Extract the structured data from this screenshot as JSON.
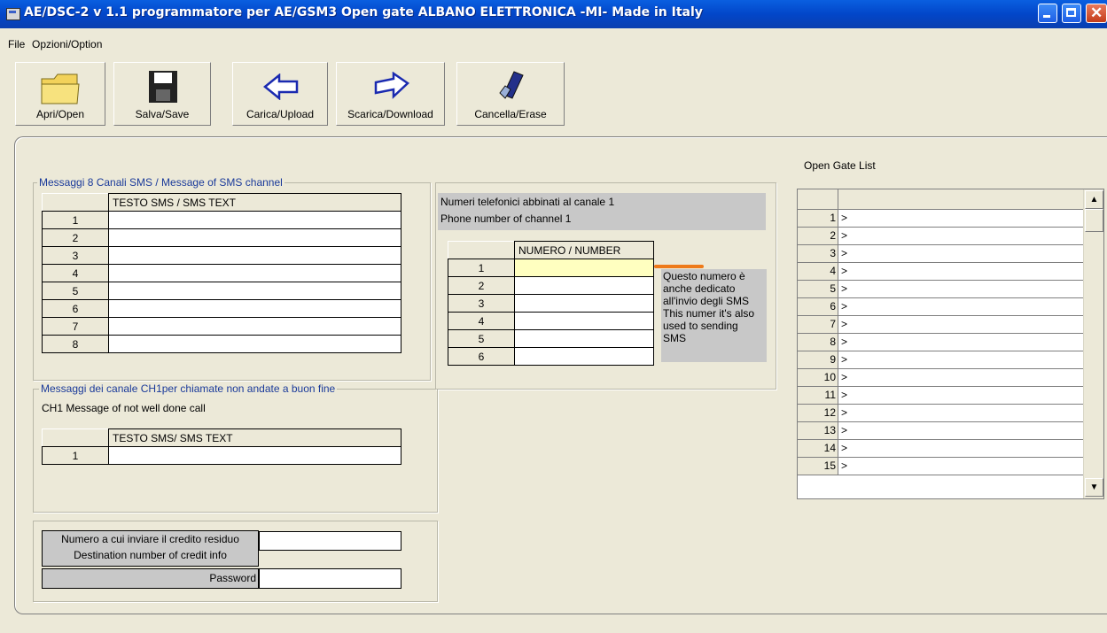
{
  "window": {
    "title": "AE/DSC-2 v 1.1 programmatore per AE/GSM3 Open gate ALBANO ELETTRONICA -MI- Made in Italy"
  },
  "menu": [
    "File",
    "Opzioni/Option"
  ],
  "toolbar": {
    "open": "Apri/Open",
    "save": "Salva/Save",
    "upload": "Carica/Upload",
    "download": "Scarica/Download",
    "erase": "Cancella/Erase"
  },
  "sms_channels": {
    "title": "Messaggi 8 Canali SMS / Message of SMS channel",
    "header": "TESTO SMS / SMS TEXT",
    "rows": [
      "1",
      "2",
      "3",
      "4",
      "5",
      "6",
      "7",
      "8"
    ],
    "values": [
      "",
      "",
      "",
      "",
      "",
      "",
      "",
      ""
    ]
  },
  "phone_numbers": {
    "caption_line1": "Numeri telefonici abbinati al canale 1",
    "caption_line2": "Phone number of channel 1",
    "header": "NUMERO / NUMBER",
    "rows": [
      "1",
      "2",
      "3",
      "4",
      "5",
      "6"
    ],
    "values": [
      "",
      "",
      "",
      "",
      "",
      ""
    ],
    "note": [
      "Questo numero è",
      "anche dedicato",
      "all'invio degli SMS",
      "This numer it's also",
      "used to sending",
      "SMS"
    ]
  },
  "failed_call": {
    "title": "Messaggi dei canale CH1per chiamate non andate a buon fine",
    "subtitle": "CH1 Message of not well done call",
    "header": "TESTO SMS/ SMS TEXT",
    "rows": [
      "1"
    ],
    "values": [
      ""
    ]
  },
  "credit": {
    "label_line1": "Numero a cui inviare il credito residuo",
    "label_line2": "Destination number of credit info",
    "password_label": "Password",
    "number_value": "",
    "password_value": ""
  },
  "open_gate": {
    "title": "Open Gate List",
    "rows": [
      "1",
      "2",
      "3",
      "4",
      "5",
      "6",
      "7",
      "8",
      "9",
      "10",
      "11",
      "12",
      "13",
      "14",
      "15"
    ],
    "marker": ">",
    "scroll_up": "▲",
    "scroll_down": "▼"
  },
  "colors": {
    "titlebar": "#0246c9",
    "face": "#ece9d8",
    "group_label": "#1a3a9a",
    "highlight_cell": "#ffffc0",
    "pointer": "#ee7a1a"
  }
}
